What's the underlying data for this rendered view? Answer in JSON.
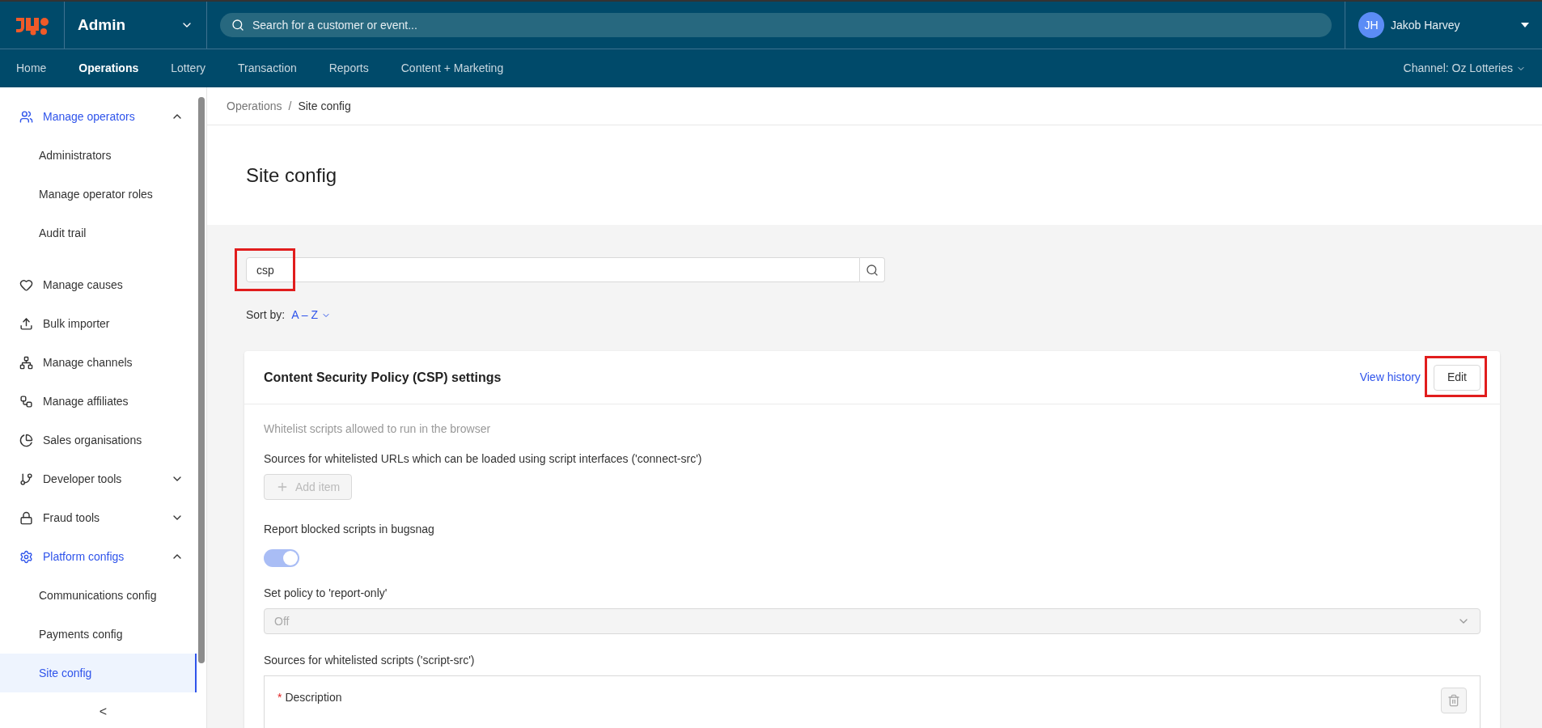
{
  "header": {
    "app_title": "Admin",
    "search": {
      "placeholder": "Search for a customer or event..."
    },
    "user": {
      "initials": "JH",
      "name": "Jakob Harvey"
    }
  },
  "nav": {
    "tabs": [
      {
        "label": "Home",
        "selected": false
      },
      {
        "label": "Operations",
        "selected": true
      },
      {
        "label": "Lottery",
        "selected": false
      },
      {
        "label": "Transaction",
        "selected": false
      },
      {
        "label": "Reports",
        "selected": false
      },
      {
        "label": "Content + Marketing",
        "selected": false
      }
    ],
    "channel": "Channel: Oz Lotteries"
  },
  "sidebar": {
    "items": [
      {
        "kind": "group",
        "label": "Manage operators",
        "active": true,
        "expanded": true,
        "children": [
          {
            "label": "Administrators",
            "selected": false
          },
          {
            "label": "Manage operator roles",
            "selected": false
          },
          {
            "label": "Audit trail",
            "selected": false
          }
        ]
      },
      {
        "kind": "link",
        "label": "Manage causes",
        "active": false
      },
      {
        "kind": "link",
        "label": "Bulk importer",
        "active": false
      },
      {
        "kind": "link",
        "label": "Manage channels",
        "active": false
      },
      {
        "kind": "link",
        "label": "Manage affiliates",
        "active": false
      },
      {
        "kind": "link",
        "label": "Sales organisations",
        "active": false
      },
      {
        "kind": "group",
        "label": "Developer tools",
        "active": false,
        "expanded": false
      },
      {
        "kind": "group",
        "label": "Fraud tools",
        "active": false,
        "expanded": false
      },
      {
        "kind": "group",
        "label": "Platform configs",
        "active": true,
        "expanded": true,
        "children": [
          {
            "label": "Communications config",
            "selected": false
          },
          {
            "label": "Payments config",
            "selected": false
          },
          {
            "label": "Site config",
            "selected": true
          }
        ]
      }
    ],
    "collapse": "<"
  },
  "breadcrumb": {
    "items": [
      "Operations",
      "Site config"
    ],
    "separator": "/"
  },
  "page_title": "Site config",
  "filter": {
    "value": "csp",
    "highlighted": true,
    "sort_label": "Sort by:",
    "sort_value": "A – Z"
  },
  "card": {
    "title": "Content Security Policy (CSP) settings",
    "view_history": "View history",
    "edit": {
      "label": "Edit",
      "highlighted": true
    },
    "fields": [
      {
        "kind": "hint",
        "text": "Whitelist scripts allowed to run in the browser"
      },
      {
        "kind": "list",
        "label": "Sources for whitelisted URLs which can be loaded using script interfaces ('connect-src')",
        "button": "Add item",
        "disabled": true
      },
      {
        "kind": "toggle",
        "label": "Report blocked scripts in bugsnag",
        "on": true,
        "disabled": true
      },
      {
        "kind": "select",
        "label": "Set policy to 'report-only'",
        "value": "Off",
        "disabled": true
      },
      {
        "kind": "group",
        "label": "Sources for whitelisted scripts ('script-src')",
        "inner_label": "Description",
        "required_mark": "*"
      }
    ]
  }
}
